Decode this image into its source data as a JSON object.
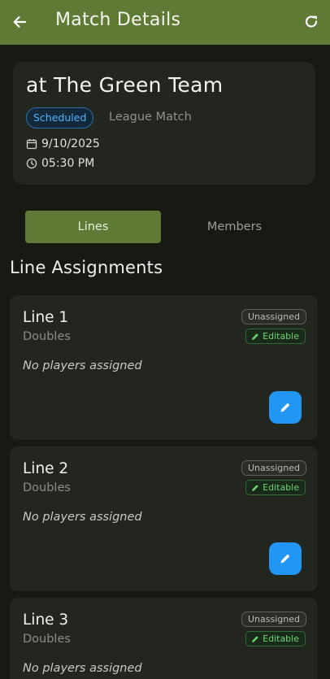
{
  "app_bar": {
    "title": "Match Details",
    "back_icon": "arrow-left-icon",
    "refresh_icon": "refresh-icon",
    "color": "#5f7a35"
  },
  "match": {
    "opponent": "at The Green Team",
    "status": "Scheduled",
    "match_type": "League Match",
    "date": "9/10/2025",
    "time": "05:30 PM"
  },
  "tabs": [
    {
      "label": "Lines",
      "selected": true
    },
    {
      "label": "Members",
      "selected": false
    }
  ],
  "section": {
    "title": "Line Assignments"
  },
  "lines": [
    {
      "name": "Line 1",
      "format": "Doubles",
      "players": "No players assigned",
      "status": "Unassigned",
      "edit_badge": "Editable"
    },
    {
      "name": "Line 2",
      "format": "Doubles",
      "players": "No players assigned",
      "status": "Unassigned",
      "edit_badge": "Editable"
    },
    {
      "name": "Line 3",
      "format": "Doubles",
      "players": "No players assigned",
      "status": "Unassigned",
      "edit_badge": "Editable"
    }
  ],
  "colors": {
    "accent": "#5f7a35",
    "fab": "#2196f3",
    "editable": "#6fd474",
    "scheduled": "#4fb3ff"
  }
}
